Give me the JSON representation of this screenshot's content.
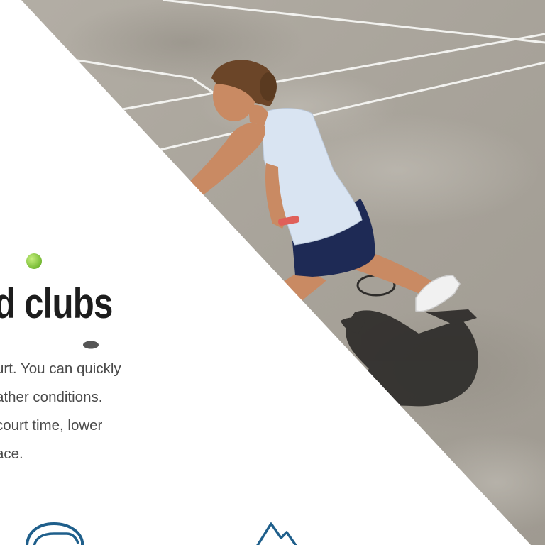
{
  "headline": {
    "text": "d clubs"
  },
  "body_copy": {
    "lines": [
      "urt. You can quickly",
      "ather conditions.",
      "court time, lower",
      "ace."
    ]
  },
  "feature_icons": [
    {
      "name": "chat-bubble-icon",
      "color": "#1f5f8b"
    },
    {
      "name": "mountain-icon",
      "color": "#1f5f8b"
    }
  ],
  "colors": {
    "court": "#a9a49b",
    "court_line": "#f2f2ef",
    "ball": "#8ed14a",
    "text_dark": "#1d1d1d",
    "text_body": "#4a4a4a",
    "icon_blue": "#1f5f8b"
  }
}
